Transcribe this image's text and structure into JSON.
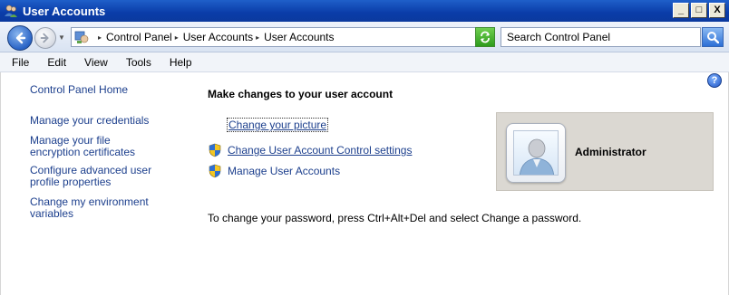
{
  "window": {
    "title": "User Accounts",
    "icon": "user-accounts-icon",
    "controls": {
      "minimize": "_",
      "maximize": "□",
      "close": "X"
    }
  },
  "toolbar": {
    "breadcrumbs": [
      "Control Panel",
      "User Accounts",
      "User Accounts"
    ],
    "search_placeholder": "Search Control Panel"
  },
  "menu": [
    "File",
    "Edit",
    "View",
    "Tools",
    "Help"
  ],
  "sidebar": {
    "home": "Control Panel Home",
    "links": [
      "Manage your credentials",
      "Manage your file encryption certificates",
      "Configure advanced user profile properties",
      "Change my environment variables"
    ]
  },
  "main": {
    "heading": "Make changes to your user account",
    "tasks": [
      {
        "label": "Change your picture",
        "icon": ""
      },
      {
        "label": "Change User Account Control settings",
        "icon": "uac-shield-icon"
      },
      {
        "label": "Manage User Accounts",
        "icon": "uac-shield-icon"
      }
    ],
    "note": "To change your password, press Ctrl+Alt+Del and select Change a password."
  },
  "user": {
    "name": "Administrator"
  },
  "colors": {
    "link": "#1c3f8d",
    "titlebar": "#0a3ca8",
    "user_panel": "#dbd8d2"
  }
}
